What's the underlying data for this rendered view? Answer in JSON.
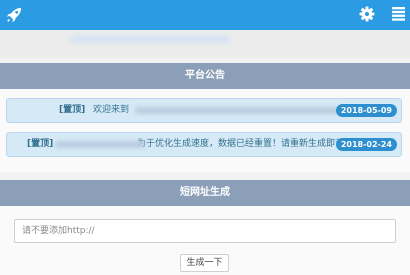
{
  "header": {
    "logo_icon": "rocket-icon",
    "settings_icon": "gear-icon",
    "menu_icon": "list-menu-icon",
    "accent_color": "#2b9be3"
  },
  "announcements": {
    "title": "平台公告",
    "items": [
      {
        "tag": "[置顶]",
        "text": "欢迎来到",
        "date": "2018-05-09"
      },
      {
        "tag": "[置顶]",
        "text": "为于优化生成速度，数据已经重置！请重新生成即可！",
        "date": "2018-02-24"
      }
    ]
  },
  "shortener": {
    "title": "短网址生成",
    "input_placeholder": "请不要添加http://",
    "button_label": "生成一下"
  }
}
